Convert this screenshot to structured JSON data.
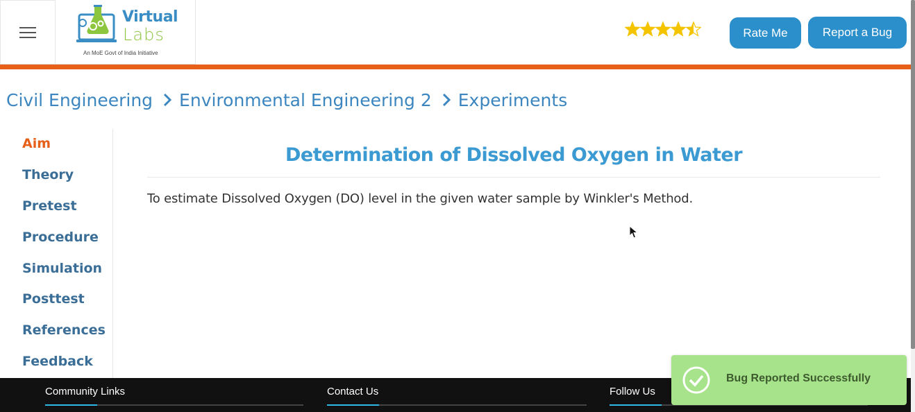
{
  "header": {
    "menu_icon": "hamburger-menu-icon",
    "logo": {
      "word1": "Virtual",
      "word2": "Labs",
      "tagline": "An MoE Govt of India Initiative"
    },
    "rating": {
      "value": 4.5,
      "max": 5,
      "icon": "star-icon",
      "color": "#f5c400"
    },
    "buttons": {
      "rate_label": "Rate Me",
      "bug_label": "Report a Bug"
    },
    "accent_color": "#e6601a",
    "button_color": "#2b8fcb"
  },
  "breadcrumb": {
    "items": [
      "Civil Engineering",
      "Environmental Engineering 2",
      "Experiments"
    ],
    "separator_icon": "chevron-right-icon"
  },
  "sidebar": {
    "items": [
      {
        "label": "Aim",
        "active": true
      },
      {
        "label": "Theory",
        "active": false
      },
      {
        "label": "Pretest",
        "active": false
      },
      {
        "label": "Procedure",
        "active": false
      },
      {
        "label": "Simulation",
        "active": false
      },
      {
        "label": "Posttest",
        "active": false
      },
      {
        "label": "References",
        "active": false
      },
      {
        "label": "Feedback",
        "active": false
      }
    ]
  },
  "main": {
    "title": "Determination of Dissolved Oxygen in Water",
    "text": "To estimate Dissolved Oxygen (DO) level in the given water sample by Winkler's Method."
  },
  "footer": {
    "columns": [
      "Community Links",
      "Contact Us",
      "Follow Us"
    ]
  },
  "toast": {
    "icon": "check-circle-icon",
    "message": "Bug Reported Successfully",
    "color": "#a7e38a"
  }
}
